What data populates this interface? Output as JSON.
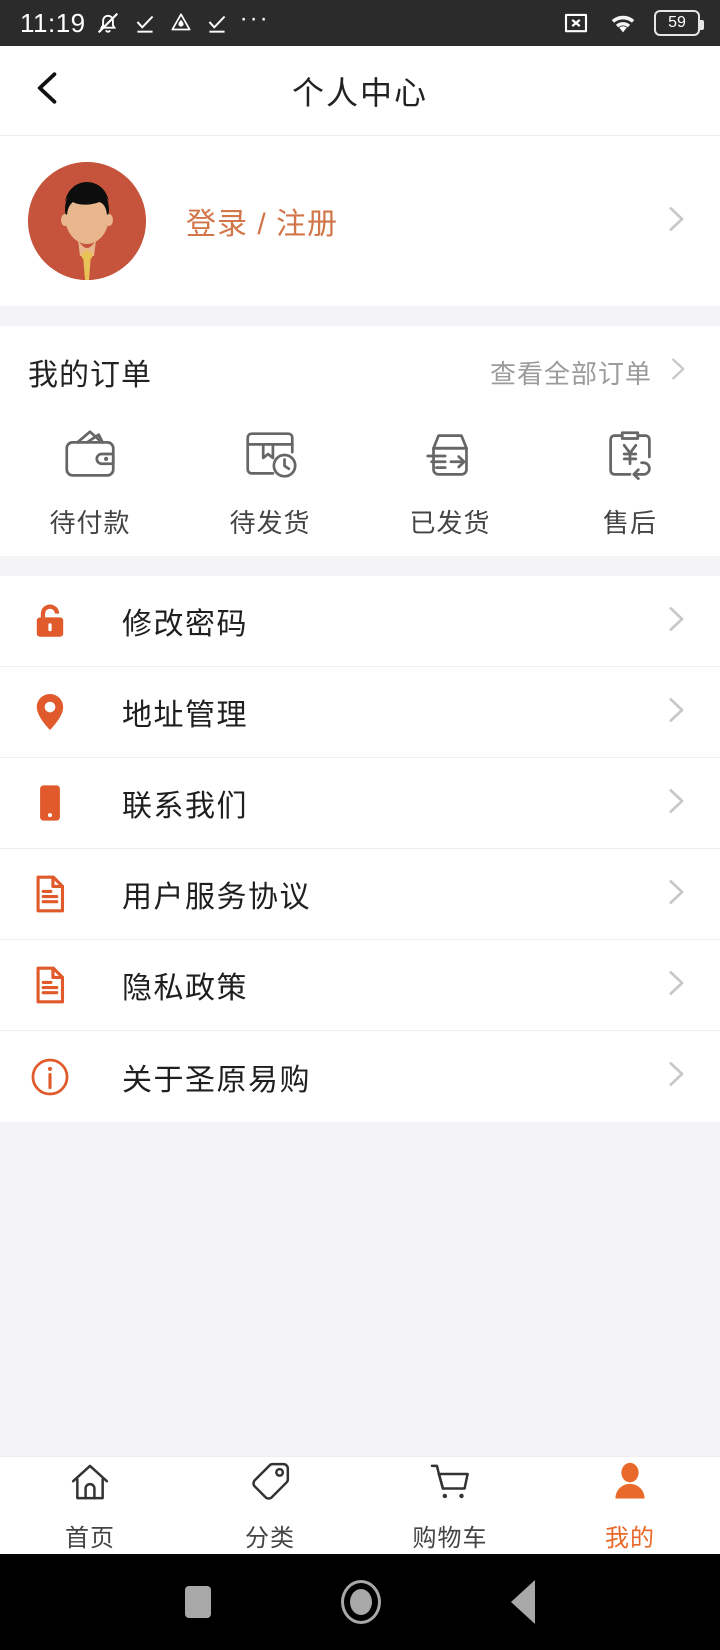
{
  "statusbar": {
    "time": "11:19",
    "battery_level": "59",
    "left_icons": [
      "bell-muted-icon",
      "check-underline-icon",
      "triangle-drop-icon",
      "check-underline-icon",
      "ellipsis-icon"
    ],
    "right_icons": [
      "x-box-icon",
      "wifi-icon",
      "battery-icon"
    ]
  },
  "header": {
    "title": "个人中心",
    "back_icon": "chevron-left-icon"
  },
  "profile": {
    "login_label": "登录 / 注册",
    "avatar_icon": "user-avatar",
    "chevron_icon": "chevron-right-icon",
    "avatar_bg": "#c6543c",
    "accent": "#d2764a"
  },
  "orders": {
    "title": "我的订单",
    "view_all_label": "查看全部订单",
    "view_all_chevron": "chevron-right-icon",
    "types": [
      {
        "label": "待付款",
        "icon": "wallet-icon"
      },
      {
        "label": "待发货",
        "icon": "box-clock-icon"
      },
      {
        "label": "已发货",
        "icon": "box-arrow-icon"
      },
      {
        "label": "售后",
        "icon": "clipboard-yen-return-icon"
      }
    ]
  },
  "menu": {
    "items": [
      {
        "label": "修改密码",
        "icon": "lock-icon"
      },
      {
        "label": "地址管理",
        "icon": "location-pin-icon"
      },
      {
        "label": "联系我们",
        "icon": "phone-icon"
      },
      {
        "label": "用户服务协议",
        "icon": "document-icon"
      },
      {
        "label": "隐私政策",
        "icon": "document-icon"
      },
      {
        "label": "关于圣原易购",
        "icon": "info-circle-icon"
      }
    ],
    "chevron_icon": "chevron-right-icon",
    "icon_color": "#e05a2b"
  },
  "tabbar": {
    "active_color": "#e8692a",
    "items": [
      {
        "label": "首页",
        "icon": "home-icon",
        "active": false
      },
      {
        "label": "分类",
        "icon": "tag-icon",
        "active": false
      },
      {
        "label": "购物车",
        "icon": "cart-icon",
        "active": false
      },
      {
        "label": "我的",
        "icon": "person-icon",
        "active": true
      }
    ]
  },
  "androidnav": {
    "buttons": [
      "recents-square-icon",
      "home-circle-icon",
      "back-triangle-icon"
    ]
  }
}
